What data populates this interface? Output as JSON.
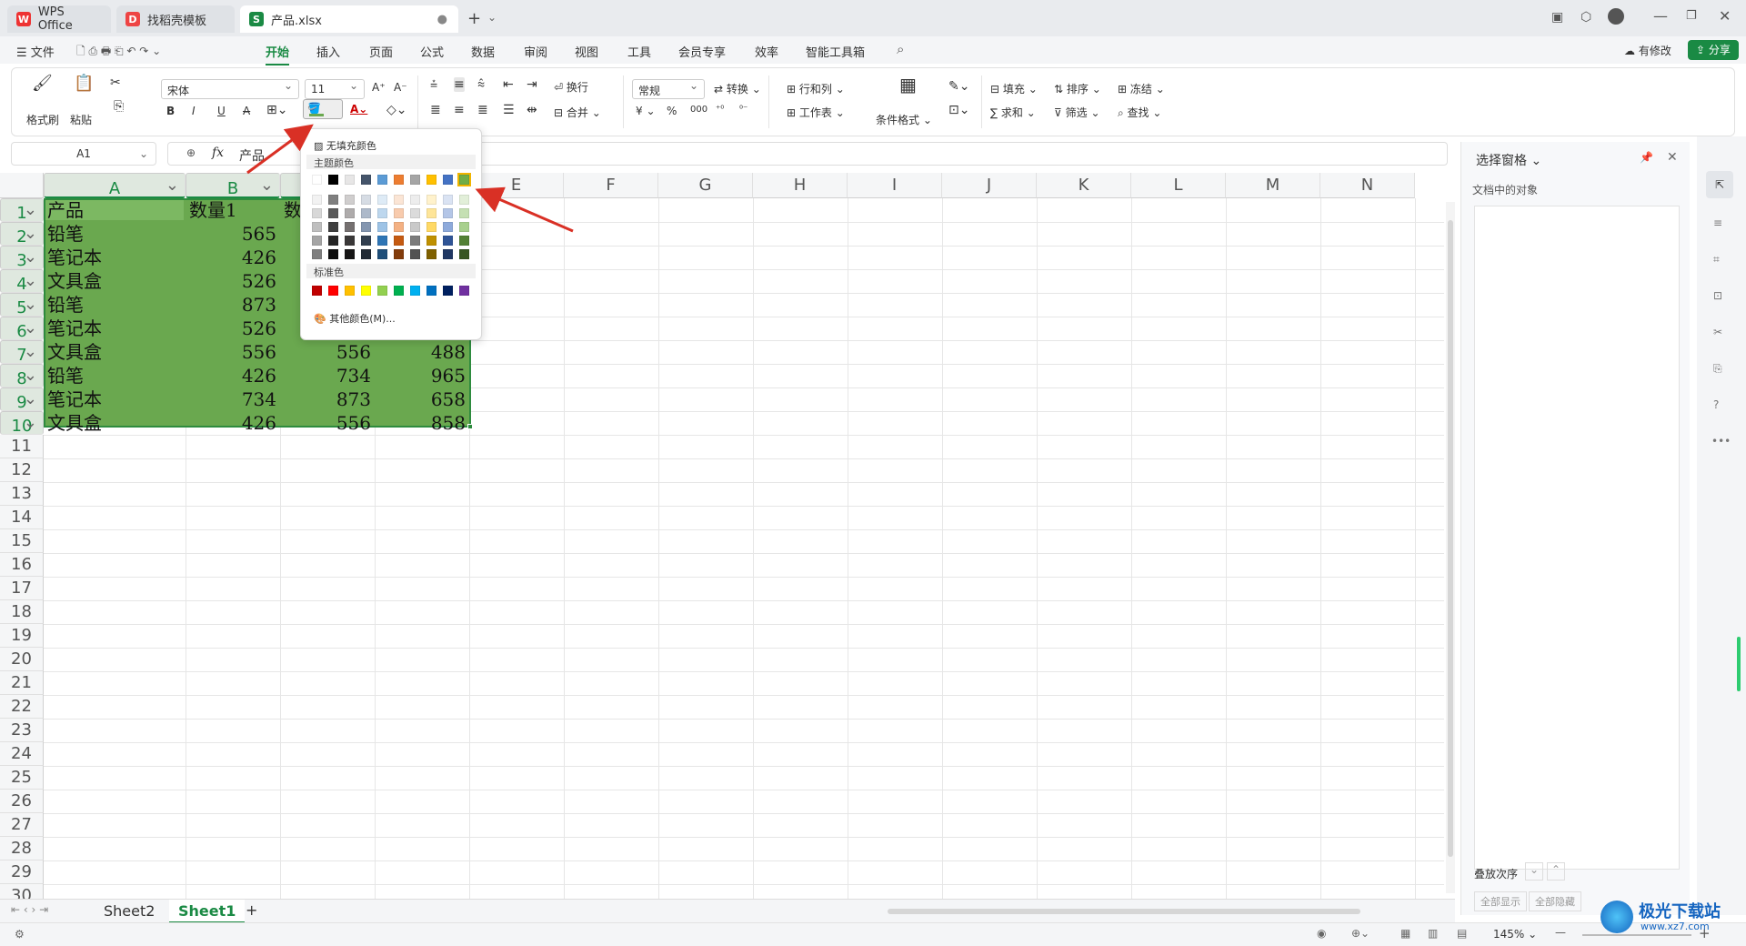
{
  "tabs": [
    {
      "label": "WPS Office"
    },
    {
      "label": "找稻壳模板"
    },
    {
      "label": "产品.xlsx"
    }
  ],
  "menu": {
    "file": "文件",
    "items": [
      "开始",
      "插入",
      "页面",
      "公式",
      "数据",
      "审阅",
      "视图",
      "工具",
      "会员专享",
      "效率",
      "智能工具箱"
    ],
    "modified": "有修改",
    "share": "分享"
  },
  "ribbon": {
    "format_painter": "格式刷",
    "paste": "粘贴",
    "font_name": "宋体",
    "font_size": "11",
    "wrap": "换行",
    "number_format": "常规",
    "convert": "转换",
    "row_col": "行和列",
    "merge": "合并",
    "worksheet": "工作表",
    "cond_format": "条件格式",
    "fill": "填充",
    "sort": "排序",
    "freeze": "冻结",
    "sum": "求和",
    "filter": "筛选",
    "find": "查找"
  },
  "formula": {
    "cell_ref": "A1",
    "fx": "fx",
    "content": "产品"
  },
  "columns": [
    "A",
    "B",
    "C",
    "D",
    "E",
    "F",
    "G",
    "H",
    "I",
    "J",
    "K",
    "L",
    "M",
    "N"
  ],
  "table": {
    "headers": [
      "产品",
      "数量1",
      "数量2",
      ""
    ],
    "rows": [
      [
        "铅笔",
        "565",
        "",
        ""
      ],
      [
        "笔记本",
        "426",
        "",
        ""
      ],
      [
        "文具盒",
        "526",
        "",
        ""
      ],
      [
        "铅笔",
        "873",
        "",
        ""
      ],
      [
        "笔记本",
        "526",
        "",
        ""
      ],
      [
        "文具盒",
        "556",
        "556",
        "488"
      ],
      [
        "铅笔",
        "426",
        "734",
        "965"
      ],
      [
        "笔记本",
        "734",
        "873",
        "658"
      ],
      [
        "文具盒",
        "426",
        "556",
        "858"
      ]
    ]
  },
  "palette": {
    "no_fill": "无填充颜色",
    "theme_title": "主题颜色",
    "standard_title": "标准色",
    "more": "其他颜色(M)...",
    "theme_top": [
      "#ffffff",
      "#000000",
      "#e7e6e6",
      "#44546a",
      "#5b9bd5",
      "#ed7d31",
      "#a5a5a5",
      "#ffc000",
      "#4472c4",
      "#70ad47"
    ],
    "theme_shades": [
      [
        "#f2f2f2",
        "#7f7f7f",
        "#d0cece",
        "#d6dce4",
        "#deebf6",
        "#fbe5d5",
        "#ededed",
        "#fff2cc",
        "#dae3f3",
        "#e2efd9"
      ],
      [
        "#d8d8d8",
        "#595959",
        "#aeabab",
        "#adb9ca",
        "#bdd7ee",
        "#f8cbad",
        "#dbdbdb",
        "#fee599",
        "#b4c6e7",
        "#c5e0b3"
      ],
      [
        "#bfbfbf",
        "#3f3f3f",
        "#757070",
        "#8496b0",
        "#9dc3e6",
        "#f4b183",
        "#c9c9c9",
        "#ffd965",
        "#8eaadb",
        "#a8d08d"
      ],
      [
        "#a5a5a5",
        "#262626",
        "#3a3838",
        "#323f4f",
        "#2e75b5",
        "#c55a11",
        "#7b7b7b",
        "#bf9000",
        "#2f5496",
        "#538135"
      ],
      [
        "#7f7f7f",
        "#0c0c0c",
        "#171616",
        "#222a35",
        "#1e4e79",
        "#833c0b",
        "#525252",
        "#7f6000",
        "#203864",
        "#375623"
      ]
    ],
    "standard": [
      "#c00000",
      "#ff0000",
      "#ffc000",
      "#ffff00",
      "#92d050",
      "#00b050",
      "#00b0f0",
      "#0070c0",
      "#002060",
      "#7030a0"
    ]
  },
  "side_panel": {
    "title": "选择窗格",
    "subtitle": "文档中的对象",
    "order": "叠放次序",
    "show_all": "全部显示",
    "hide_all": "全部隐藏"
  },
  "sheets": [
    "Sheet2",
    "Sheet1"
  ],
  "status": {
    "zoom": "145%"
  },
  "watermark": {
    "text": "极光下载站",
    "url": "www.xz7.com"
  },
  "colors": {
    "accent": "#1a8a44",
    "selection_fill": "#6aa84f",
    "arrow": "#d93025"
  }
}
